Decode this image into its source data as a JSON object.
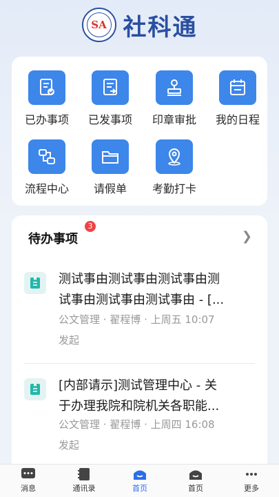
{
  "header": {
    "title": "社科通",
    "logo_text": "SA"
  },
  "quick_actions": [
    {
      "label": "已办事项",
      "icon": "done-document-icon"
    },
    {
      "label": "已发事项",
      "icon": "sent-document-icon"
    },
    {
      "label": "印章审批",
      "icon": "stamp-icon"
    },
    {
      "label": "我的日程",
      "icon": "calendar-icon"
    },
    {
      "label": "流程中心",
      "icon": "workflow-icon"
    },
    {
      "label": "请假单",
      "icon": "folder-icon"
    },
    {
      "label": "考勤打卡",
      "icon": "location-pin-icon"
    }
  ],
  "todo": {
    "title": "待办事项",
    "badge": "3",
    "items": [
      {
        "line1": "测试事由测试事由测试事由测",
        "line2": "试事由测试事由测试事由 - [...",
        "meta1": "公文管理 · 翟程博 · 上周五 10:07",
        "meta2": "发起"
      },
      {
        "line1": "[内部请示]测试管理中心 - 关",
        "line2": "于办理我院和院机关各职能...",
        "meta1": "公文管理 · 翟程博 · 上周四 16:08",
        "meta2": "发起"
      }
    ]
  },
  "tabbar": [
    {
      "label": "消息",
      "icon": "message-icon",
      "active": false
    },
    {
      "label": "通讯录",
      "icon": "contacts-icon",
      "active": false
    },
    {
      "label": "首页",
      "icon": "home-icon",
      "active": true
    },
    {
      "label": "首页",
      "icon": "home-icon",
      "active": false
    },
    {
      "label": "更多",
      "icon": "more-icon",
      "active": false
    }
  ],
  "colors": {
    "accent": "#3d86ea",
    "active_tab": "#2b6ee8",
    "badge": "#f04444",
    "brand": "#2a4fa0"
  }
}
